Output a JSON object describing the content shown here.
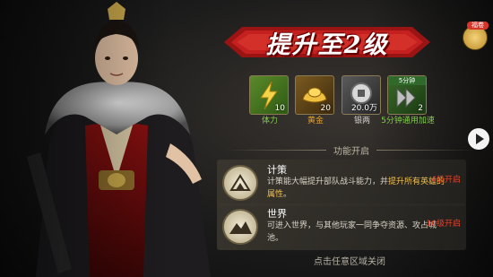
{
  "title": "提升至2级",
  "side_button_tag": "福卷",
  "rewards": [
    {
      "label": "体力",
      "count": "10",
      "icon": "stamina-bolt-icon"
    },
    {
      "label": "黄金",
      "count": "20",
      "icon": "gold-ingot-icon"
    },
    {
      "label": "银两",
      "count": "20.0万",
      "icon": "silver-coin-icon"
    },
    {
      "label": "5分钟通用加速",
      "count": "2",
      "tag": "5分钟",
      "icon": "speedup-icon"
    }
  ],
  "section_label": "功能开启",
  "features": [
    {
      "name": "计策",
      "desc_plain": "计策能大幅提升部队战斗能力，并",
      "desc_highlight": "提升所有英雄的属性",
      "desc_end": "。",
      "level": "4级开启",
      "icon": "strategy-mountain-icon"
    },
    {
      "name": "世界",
      "desc_plain": "可进入世界，与其他玩家一同争夺资源、攻占城池。",
      "level": "10级开启",
      "icon": "world-mountain-icon"
    }
  ],
  "close_hint": "点击任意区域关闭",
  "colors": {
    "accent_red": "#e4432b",
    "accent_gold": "#e8c45a",
    "highlight": "#f0c050"
  }
}
